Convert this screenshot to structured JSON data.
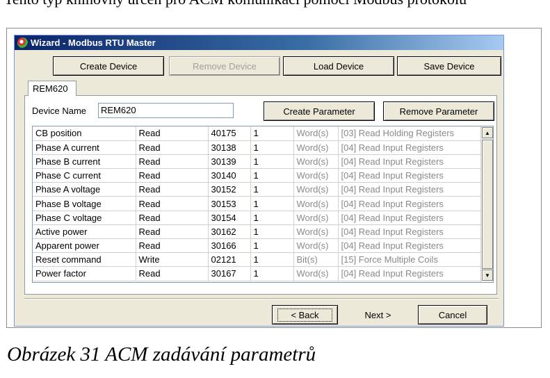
{
  "page_top_text": "Tento typ knihovny určen pro ACM komunikaci pomocí Modbus protokolu",
  "window": {
    "title": "Wizard - Modbus RTU Master"
  },
  "toolbar": {
    "create_device": "Create Device",
    "remove_device": "Remove Device",
    "load_device": "Load Device",
    "save_device": "Save Device"
  },
  "tabs": [
    {
      "label": "REM620"
    }
  ],
  "device": {
    "name_label": "Device Name",
    "name_value": "REM620",
    "create_parameter": "Create Parameter",
    "remove_parameter": "Remove Parameter"
  },
  "parameters": [
    {
      "name": "CB position",
      "access": "Read",
      "address": "40175",
      "count": "1",
      "unit": "Word(s)",
      "function": "[03] Read Holding Registers"
    },
    {
      "name": "Phase A current",
      "access": "Read",
      "address": "30138",
      "count": "1",
      "unit": "Word(s)",
      "function": "[04] Read Input Registers"
    },
    {
      "name": "Phase B current",
      "access": "Read",
      "address": "30139",
      "count": "1",
      "unit": "Word(s)",
      "function": "[04] Read Input Registers"
    },
    {
      "name": "Phase C current",
      "access": "Read",
      "address": "30140",
      "count": "1",
      "unit": "Word(s)",
      "function": "[04] Read Input Registers"
    },
    {
      "name": "Phase A voltage",
      "access": "Read",
      "address": "30152",
      "count": "1",
      "unit": "Word(s)",
      "function": "[04] Read Input Registers"
    },
    {
      "name": "Phase B voltage",
      "access": "Read",
      "address": "30153",
      "count": "1",
      "unit": "Word(s)",
      "function": "[04] Read Input Registers"
    },
    {
      "name": "Phase C voltage",
      "access": "Read",
      "address": "30154",
      "count": "1",
      "unit": "Word(s)",
      "function": "[04] Read Input Registers"
    },
    {
      "name": "Active power",
      "access": "Read",
      "address": "30162",
      "count": "1",
      "unit": "Word(s)",
      "function": "[04] Read Input Registers"
    },
    {
      "name": "Apparent power",
      "access": "Read",
      "address": "30166",
      "count": "1",
      "unit": "Word(s)",
      "function": "[04] Read Input Registers"
    },
    {
      "name": "Reset command",
      "access": "Write",
      "address": "02121",
      "count": "1",
      "unit": "Bit(s)",
      "function": "[15] Force Multiple Coils"
    },
    {
      "name": "Power factor",
      "access": "Read",
      "address": "30167",
      "count": "1",
      "unit": "Word(s)",
      "function": "[04] Read Input Registers"
    }
  ],
  "footer": {
    "back": "< Back",
    "next": "Next >",
    "cancel": "Cancel"
  },
  "caption": "Obrázek 31 ACM zadávání parametrů",
  "icons": {
    "app": "wizard-logo-icon",
    "scroll_up": "arrow-up-icon",
    "scroll_down": "arrow-down-icon"
  }
}
